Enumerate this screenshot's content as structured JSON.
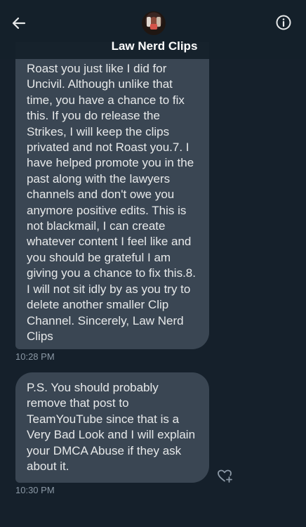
{
  "header": {
    "title": "Law Nerd Clips",
    "back_icon": "back-arrow-icon",
    "info_icon": "info-icon"
  },
  "messages": [
    {
      "text": "Roast you just like I did for Uncivil. Although unlike that time, you have a chance to fix this. If you do release the Strikes, I will keep the clips privated and not Roast you.7. I have helped promote you in the past along with the lawyers channels and don't owe you anymore positive edits. This is not blackmail, I can create whatever content I feel like and you should be grateful I am giving you a chance to fix this.8. I will not sit idly by as you try to delete another smaller Clip Channel. Sincerely,  Law Nerd Clips",
      "time": "10:28 PM"
    },
    {
      "text": "P.S. You should probably remove that post to TeamYouTube since that is a Very Bad Look and I will explain your DMCA Abuse if they ask about it.",
      "time": "10:30 PM"
    }
  ],
  "colors": {
    "background": "#15202b",
    "bubble": "#3a4653",
    "text": "#e7e9ea",
    "timestamp": "#8b98a5"
  }
}
